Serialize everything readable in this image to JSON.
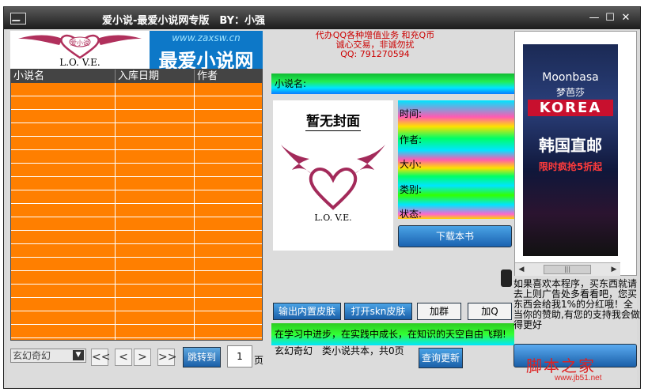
{
  "window": {
    "title": "爱小说-最爱小说网专版　BY：小强",
    "min": "—",
    "max": "☐",
    "close": "✕"
  },
  "left": {
    "logo_text": "L.O. V.E.",
    "logo_badge": "爱小说",
    "banner_url": "www.zaxsw.cn",
    "banner_big": "最爱小说网",
    "columns": [
      "小说名",
      "入库日期",
      "作者"
    ],
    "category_selected": "玄幻奇幻",
    "nav": {
      "first": "<<",
      "prev": "<",
      "next": ">",
      "last": ">>"
    },
    "jump_label": "跳转到",
    "page_value": "1",
    "page_unit": "页"
  },
  "middle": {
    "promo_line1": "代办QQ各种增值业务 和充Q币",
    "promo_line2": "诚心交易，非诚勿扰",
    "promo_line3": "QQ: 791270594",
    "name_label": "小说名:",
    "cover_title": "暂无封面",
    "cover_love": "L.O. V.E.",
    "info": {
      "time": "时间:",
      "author": "作者:",
      "size": "大小:",
      "category": "类别:",
      "status": "状态:"
    },
    "download_label": "下载本书",
    "btn_export_skin": "输出内置皮肤",
    "btn_open_skin": "打开skn皮肤",
    "btn_join_group": "加群",
    "btn_add_qq": "加Q",
    "slogan": "在学习中进步，在实践中成长，在知识的天空自由飞翔!",
    "status_text": "玄幻奇幻　类小说共本，共0页",
    "update_label": "查询更新"
  },
  "right": {
    "ad_brand": "Moonbasa",
    "ad_brand_cn": "梦芭莎",
    "ad_korea": "KOREA",
    "ad_direct": "韩国直邮",
    "ad_sale": "限时疯抢5折起",
    "note": "如果喜欢本程序，买东西就请去上则广告处多看看吧，您买东西会给我1%的分红哦！全当你的赞助,有您的支持我会做得更好",
    "watermark": "脚本之家",
    "watermark_url": "www.jb51.net"
  }
}
